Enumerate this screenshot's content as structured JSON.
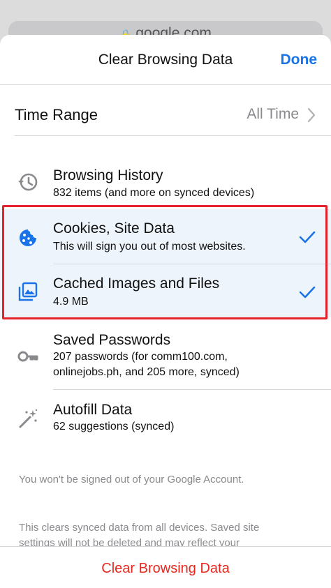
{
  "background": {
    "url": "google.com"
  },
  "header": {
    "title": "Clear Browsing Data",
    "done_label": "Done"
  },
  "time_range": {
    "label": "Time Range",
    "value": "All Time"
  },
  "items": [
    {
      "title": "Browsing History",
      "subtitle": "832 items (and more on synced devices)",
      "icon": "history-icon",
      "selected": false
    },
    {
      "title": "Cookies, Site Data",
      "subtitle": "This will sign you out of most websites.",
      "icon": "cookie-icon",
      "selected": true
    },
    {
      "title": "Cached Images and Files",
      "subtitle": "4.9 MB",
      "icon": "image-icon",
      "selected": true
    },
    {
      "title": "Saved Passwords",
      "subtitle_line1": "207 passwords (for comm100.com,",
      "subtitle_line2": "onlinejobs.ph, and 205 more, synced)",
      "icon": "key-icon",
      "selected": false
    },
    {
      "title": "Autofill Data",
      "subtitle": "62 suggestions (synced)",
      "icon": "magic-wand-icon",
      "selected": false
    }
  ],
  "notes": {
    "account": "You won't be signed out of your Google Account.",
    "synced_line1": "This clears synced data from all devices. Saved site",
    "synced_line2": "settings will not be deleted and may reflect your"
  },
  "footer": {
    "clear_label": "Clear Browsing Data"
  },
  "colors": {
    "accent": "#1a73e8",
    "destructive": "#e8271f",
    "highlight": "#e5222a",
    "selected_bg": "#eef4fc"
  }
}
